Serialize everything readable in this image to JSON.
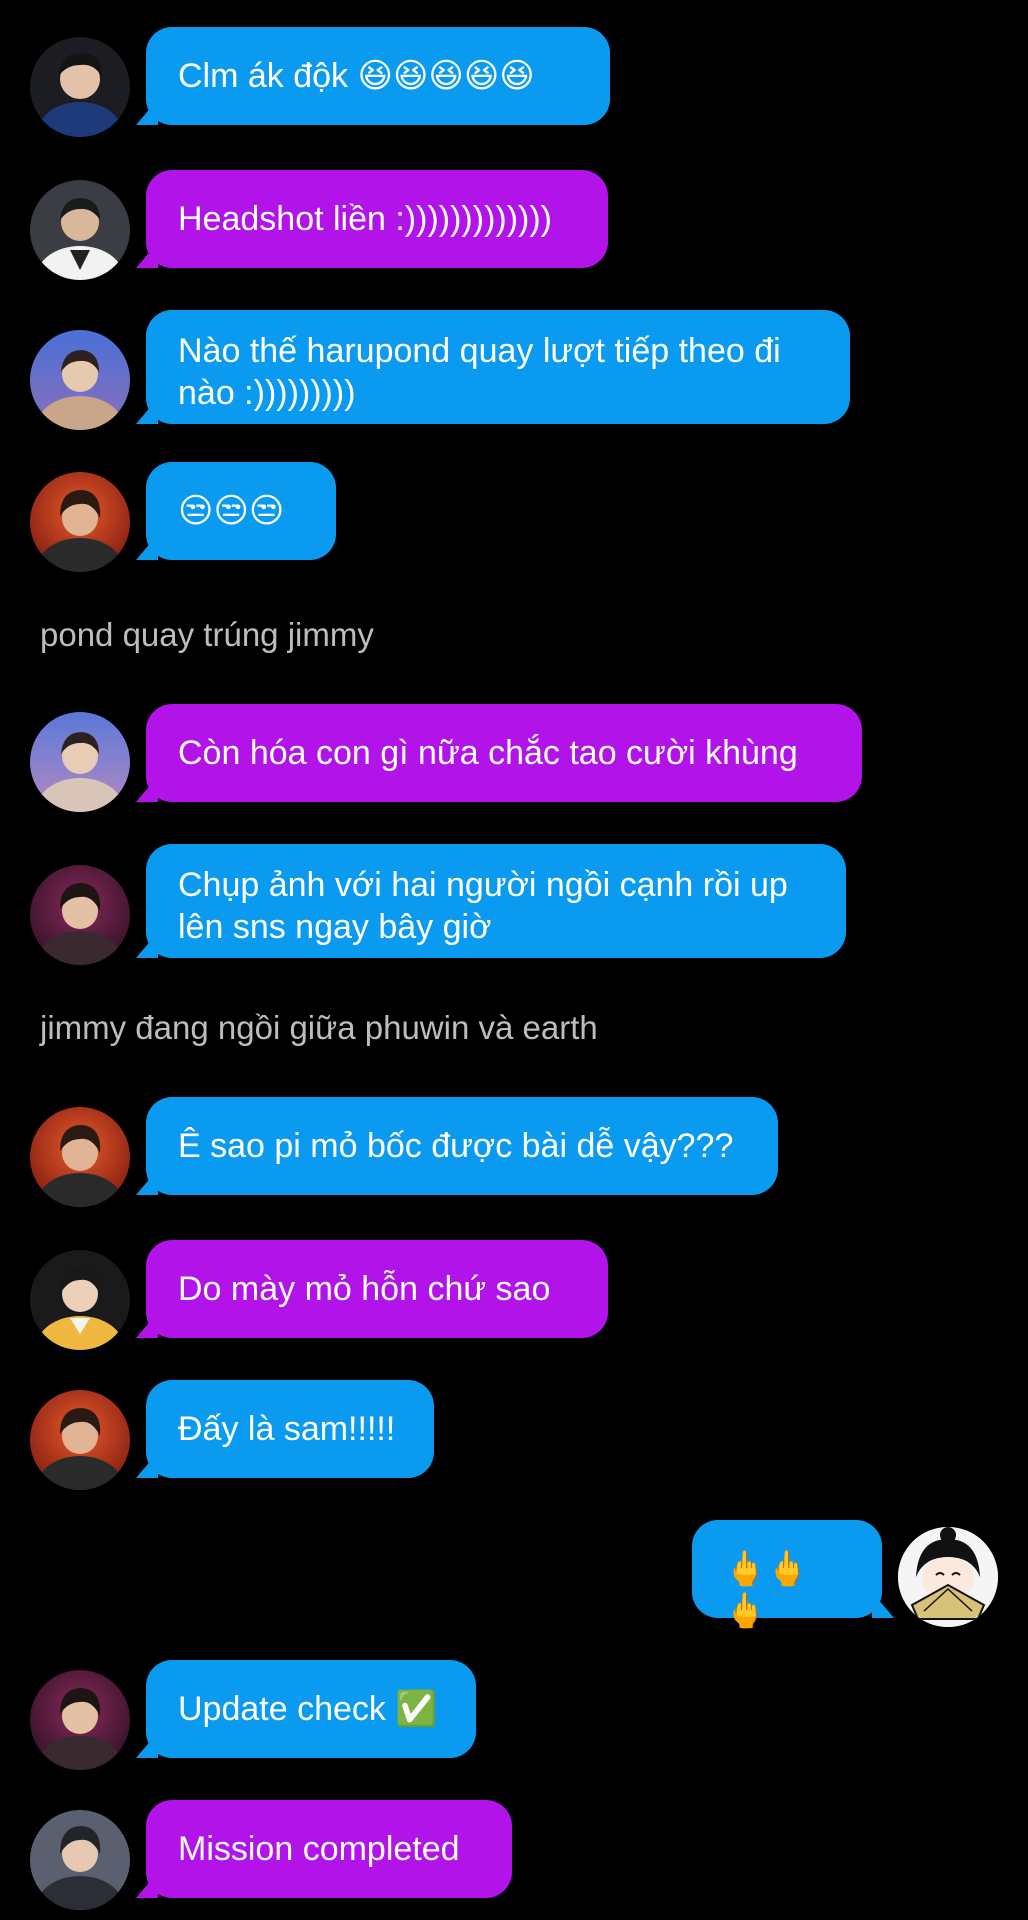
{
  "colors": {
    "background": "#000000",
    "bubble_blue": "#0a9bf0",
    "bubble_purple": "#b213e9",
    "narration_text": "#bdbdbd"
  },
  "messages": [
    {
      "type": "message",
      "side": "left",
      "bubble": "blue",
      "avatar": "avatar-1",
      "text": "Clm ák độk 😆😆😆😆😆"
    },
    {
      "type": "message",
      "side": "left",
      "bubble": "purple",
      "avatar": "avatar-2",
      "text": "Headshot liền :)))))))))))))"
    },
    {
      "type": "message",
      "side": "left",
      "bubble": "blue",
      "avatar": "avatar-3",
      "text": "Nào thế harupond quay lượt tiếp theo đi nào :)))))))))"
    },
    {
      "type": "message",
      "side": "left",
      "bubble": "blue",
      "avatar": "avatar-4",
      "text": "😒😒😒"
    },
    {
      "type": "narration",
      "text": "pond quay trúng jimmy"
    },
    {
      "type": "message",
      "side": "left",
      "bubble": "purple",
      "avatar": "avatar-3",
      "text": "Còn hóa con gì nữa chắc tao cười khùng"
    },
    {
      "type": "message",
      "side": "left",
      "bubble": "blue",
      "avatar": "avatar-5",
      "text": "Chụp ảnh với hai người ngồi cạnh rồi up lên sns ngay bây giờ"
    },
    {
      "type": "narration",
      "text": "jimmy đang ngồi giữa phuwin và earth"
    },
    {
      "type": "message",
      "side": "left",
      "bubble": "blue",
      "avatar": "avatar-4",
      "text": "Ê sao pi mỏ bốc được bài dễ vậy???"
    },
    {
      "type": "message",
      "side": "left",
      "bubble": "purple",
      "avatar": "avatar-6",
      "text": "Do mày mỏ hỗn chứ sao"
    },
    {
      "type": "message",
      "side": "left",
      "bubble": "blue",
      "avatar": "avatar-4",
      "text": "Đấy là sam!!!!!"
    },
    {
      "type": "message",
      "side": "right",
      "bubble": "blue",
      "avatar": "avatar-self",
      "text": "🖕🖕🖕"
    },
    {
      "type": "message",
      "side": "left",
      "bubble": "blue",
      "avatar": "avatar-5",
      "text": "Update check ✅"
    },
    {
      "type": "message",
      "side": "left",
      "bubble": "purple",
      "avatar": "avatar-7",
      "text": "Mission completed"
    }
  ]
}
